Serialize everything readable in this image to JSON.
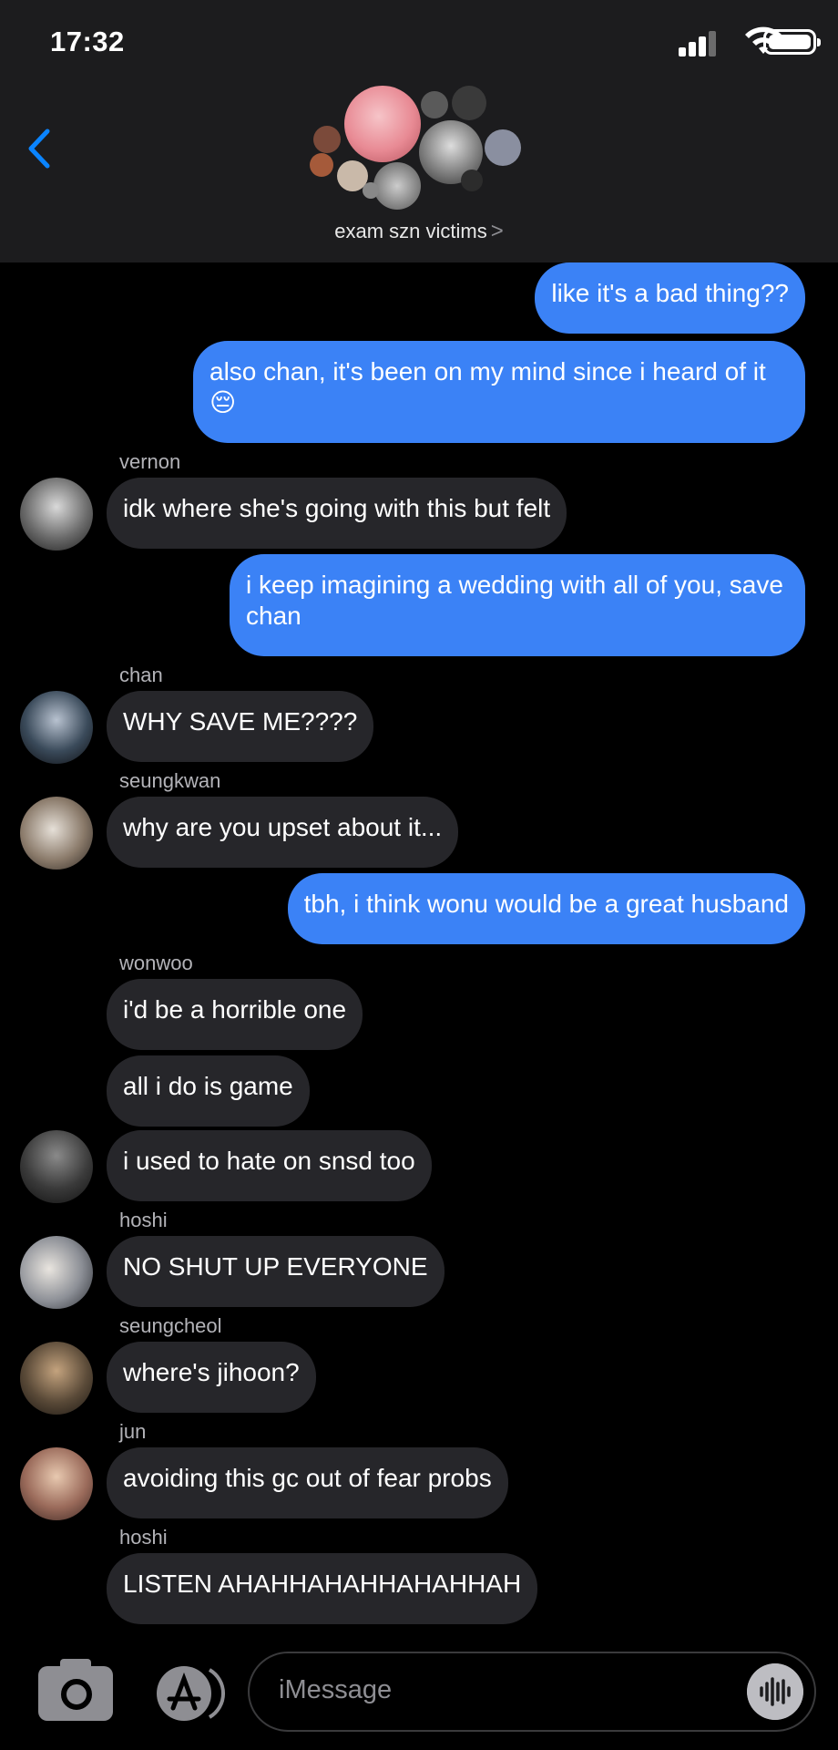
{
  "status_bar": {
    "time": "17:32"
  },
  "header": {
    "back_icon": "chevron-left-icon",
    "group_name": "exam szn victims",
    "name_chevron": ">"
  },
  "messages": [
    {
      "direction": "out",
      "text": "like it's a bad thing??"
    },
    {
      "direction": "out",
      "text": "also chan, it's been on my mind since i heard of it 😔"
    },
    {
      "direction": "in",
      "sender": "vernon",
      "text": "idk where she's going with this but felt"
    },
    {
      "direction": "out",
      "text": "i keep imagining a wedding with all of you, save chan"
    },
    {
      "direction": "in",
      "sender": "chan",
      "text": "WHY SAVE ME????"
    },
    {
      "direction": "in",
      "sender": "seungkwan",
      "text": "why are you upset about it..."
    },
    {
      "direction": "out",
      "text": "tbh, i think wonu would be a great husband"
    },
    {
      "direction": "in",
      "sender": "wonwoo",
      "text": "i'd be a horrible one"
    },
    {
      "direction": "in",
      "text": "all i do is game"
    },
    {
      "direction": "in",
      "text": "i used to hate on snsd too"
    },
    {
      "direction": "in",
      "sender": "hoshi",
      "text": "NO SHUT UP EVERYONE"
    },
    {
      "direction": "in",
      "sender": "seungcheol",
      "text": "where's jihoon?"
    },
    {
      "direction": "in",
      "sender": "jun",
      "text": "avoiding this gc out of fear probs"
    },
    {
      "direction": "in",
      "sender": "hoshi",
      "text": "LISTEN AHAHHAHAHHAHAHHAH"
    }
  ],
  "compose": {
    "placeholder": "iMessage",
    "camera_icon": "camera-icon",
    "apps_icon": "app-store-icon",
    "voice_icon": "waveform-icon"
  },
  "colors": {
    "outgoing_bubble": "#3b82f6",
    "incoming_bubble": "#26262a",
    "header_bg": "#1c1c1e",
    "link_blue": "#0a84ff"
  }
}
